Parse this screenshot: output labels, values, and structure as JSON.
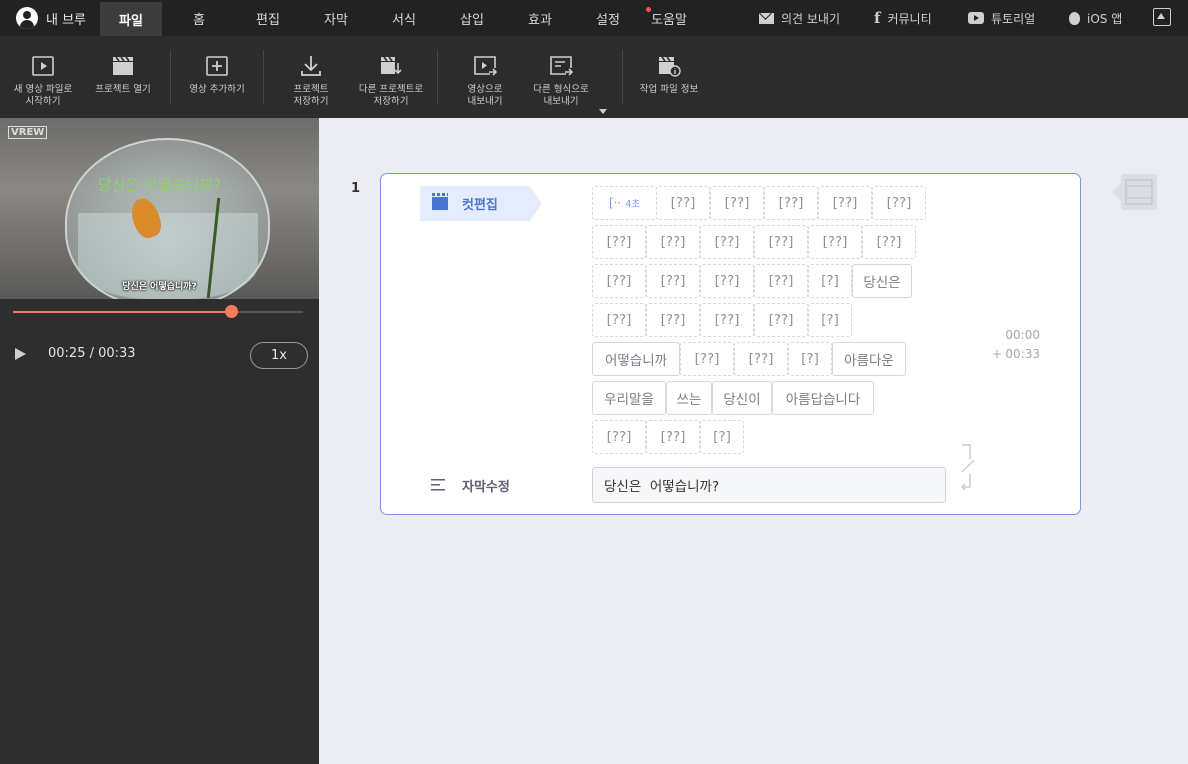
{
  "menubar": {
    "my_vrew": "내 브루",
    "tabs": [
      "파일",
      "홈",
      "편집",
      "자막",
      "서식",
      "삽입",
      "효과",
      "설정",
      "도움말"
    ],
    "active_tab": "파일",
    "feedback": "의견 보내기",
    "community": "커뮤니티",
    "tutorial": "튜토리얼",
    "ios_app": "iOS 앱"
  },
  "toolbar": {
    "new_project": [
      "새 영상 파일로",
      "시작하기"
    ],
    "open_project": "프로젝트 열기",
    "add_video": "영상 추가하기",
    "save_project": [
      "프로젝트",
      "저장하기"
    ],
    "save_as": [
      "다른 프로젝트로",
      "저장하기"
    ],
    "export_video": [
      "영상으로",
      "내보내기"
    ],
    "export_other": [
      "다른 형식으로",
      "내보내기"
    ],
    "work_file_info": "작업 파일 정보"
  },
  "player": {
    "watermark": "VREW",
    "subtitle_top": "당신은 어떻습니까?",
    "subtitle_bottom": "당신은 어떻습니까?",
    "progress": 0.752,
    "time": "00:25 / 00:33",
    "speed": "1x"
  },
  "clip": {
    "number": "1",
    "cut_edit_label": "컷편집",
    "first_token": "[··",
    "first_token_dur": "4초",
    "token_rows": [
      [
        "[??]",
        "[??]",
        "[??]",
        "[??]",
        "[??]"
      ],
      [
        "[??]",
        "[??]",
        "[??]",
        "[??]",
        "[??]",
        "[??]"
      ],
      [
        "[??]",
        "[??]",
        "[??]",
        "[??]",
        "[?]",
        "당신은"
      ],
      [
        "[??]",
        "[??]",
        "[??]",
        "[??]",
        "[?]"
      ],
      [
        "어떻습니까",
        "[??]",
        "[??]",
        "[?]",
        "아름다운"
      ],
      [
        "우리말을",
        "쓰는",
        "당신이",
        "아름답습니다"
      ],
      [
        "[??]",
        "[??]",
        "[?]"
      ]
    ],
    "timecode_start": "00:00",
    "timecode_plus": "+",
    "timecode_end": "00:33",
    "subtitle_edit_label": "자막수정",
    "subtitle_text": "당신은  어떻습니까?"
  },
  "colors": {
    "accent": "#4a74d6",
    "progress": "#f47c5a",
    "card_border": "#7b96e6"
  }
}
